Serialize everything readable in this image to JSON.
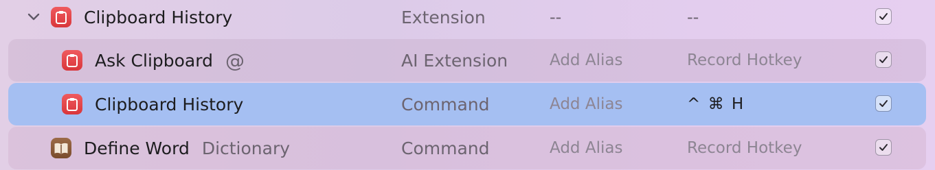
{
  "rows": [
    {
      "name": "Clipboard History",
      "type": "Extension",
      "alias": "--",
      "hotkey": "--",
      "icon": "clipboard-icon",
      "expanded": true,
      "enabled": true
    },
    {
      "name": "Ask Clipboard",
      "mention_symbol": "@",
      "type": "AI Extension",
      "alias": "Add Alias",
      "hotkey": "Record Hotkey",
      "icon": "clipboard-icon",
      "enabled": true
    },
    {
      "name": "Clipboard History",
      "type": "Command",
      "alias": "Add Alias",
      "hotkey": "^ ⌘ H",
      "icon": "clipboard-icon",
      "selected": true,
      "enabled": true
    },
    {
      "name": "Define Word",
      "subtitle": "Dictionary",
      "type": "Command",
      "alias": "Add Alias",
      "hotkey": "Record Hotkey",
      "icon": "book-icon",
      "enabled": true
    }
  ],
  "colors": {
    "selected_row": "#a5bff2",
    "clipboard_icon": "#e04449",
    "dictionary_icon": "#8a5a39"
  }
}
